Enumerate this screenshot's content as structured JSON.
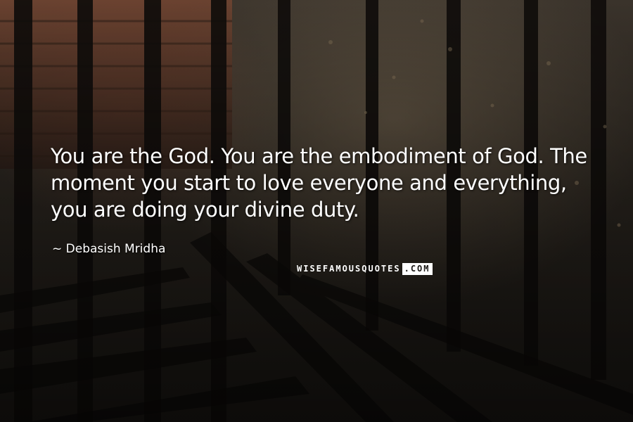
{
  "quote": {
    "text": "You are the God. You are the embodiment of God. The moment you start to love everyone and everything, you are doing your divine duty.",
    "author": "~ Debasish Mridha"
  },
  "watermark": {
    "part_a": "WISEFAMOUSQUOTES",
    "part_b": ".COM"
  },
  "background": {
    "subject": "iron-fence-shadows-over-brick-and-pavement",
    "colors": {
      "brick": "#6b3f2c",
      "ground": "#3a332b",
      "shadow": "#0d0b09"
    }
  }
}
